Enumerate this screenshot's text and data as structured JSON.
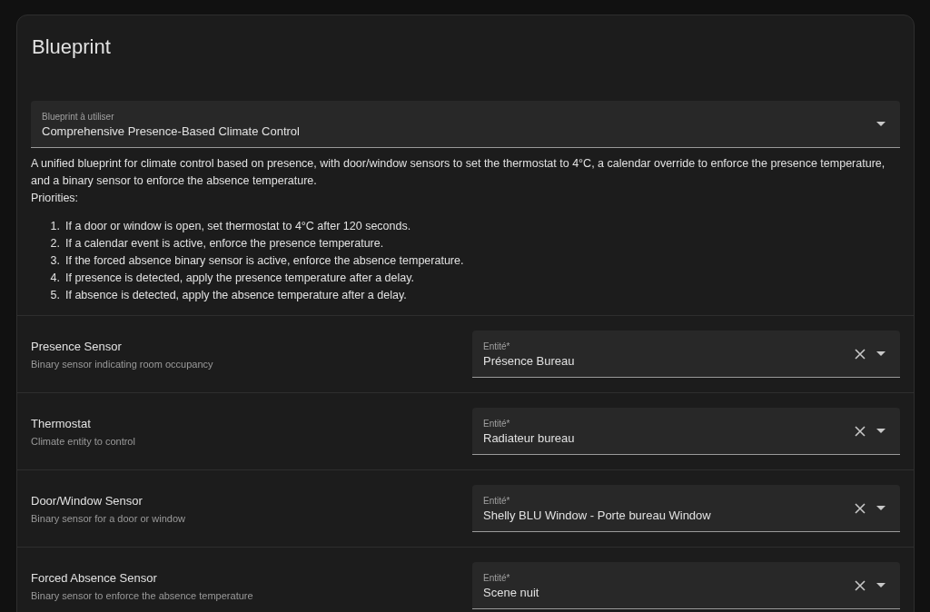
{
  "card": {
    "title": "Blueprint",
    "blueprint_select": {
      "label": "Blueprint à utiliser",
      "value": "Comprehensive Presence-Based Climate Control"
    },
    "description": "A unified blueprint for climate control based on presence, with door/window sensors to set the thermostat to 4°C, a calendar override to enforce the presence temperature, and a binary sensor to enforce the absence temperature.",
    "priorities_heading": "Priorities:",
    "priorities": [
      {
        "number": "1.",
        "text": "If a door or window is open, set thermostat to 4°C after 120 seconds."
      },
      {
        "number": "2.",
        "text": "If a calendar event is active, enforce the presence temperature."
      },
      {
        "number": "3.",
        "text": "If the forced absence binary sensor is active, enforce the absence temperature."
      },
      {
        "number": "4.",
        "text": "If presence is detected, apply the presence temperature after a delay."
      },
      {
        "number": "5.",
        "text": "If absence is detected, apply the absence temperature after a delay."
      }
    ],
    "inputs": [
      {
        "name": "Presence Sensor",
        "description": "Binary sensor indicating room occupancy",
        "field_label": "Entité*",
        "value": "Présence Bureau"
      },
      {
        "name": "Thermostat",
        "description": "Climate entity to control",
        "field_label": "Entité*",
        "value": "Radiateur bureau"
      },
      {
        "name": "Door/Window Sensor",
        "description": "Binary sensor for a door or window",
        "field_label": "Entité*",
        "value": "Shelly BLU Window - Porte bureau Window"
      },
      {
        "name": "Forced Absence Sensor",
        "description": "Binary sensor to enforce the absence temperature",
        "field_label": "Entité*",
        "value": "Scene nuit"
      }
    ]
  }
}
